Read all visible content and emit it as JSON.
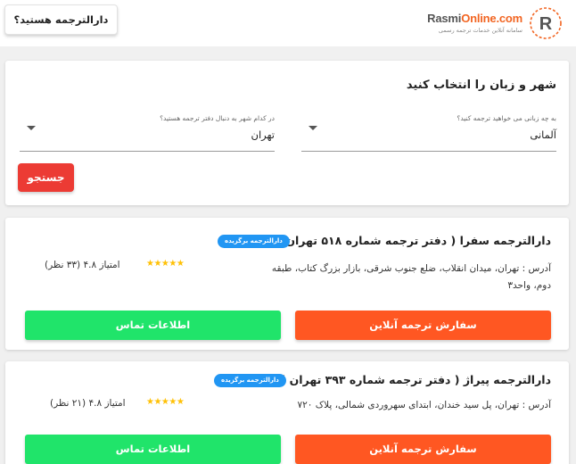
{
  "header": {
    "logo_brand": "Rasmi",
    "logo_domain": "Online.com",
    "logo_tagline": "سامانه آنلاین خدمات ترجمه رسمی",
    "question_button": "دارالترجمه هستید؟"
  },
  "search": {
    "title": "شهر و زبان را انتخاب کنید",
    "language_label": "به چه زبانی می خواهید ترجمه کنید؟",
    "language_value": "آلمانی",
    "city_label": "در کدام شهر به دنبال دفتر ترجمه هستید؟",
    "city_value": "تهران",
    "search_button": "جستجو"
  },
  "offices": [
    {
      "name": "دارالترجمه سفرا ( دفتر ترجمه شماره ۵۱۸ تهران )",
      "badge": "دارالترجمه برگزیده",
      "address": "آدرس : تهران، میدان انقلاب، ضلع جنوب شرقی، بازار بزرگ کتاب، طبقه دوم، واحد۳",
      "stars": "★★★★★",
      "rating": "امتیاز ۴.۸ (۳۳ نظر)",
      "order_button": "سفارش ترجمه آنلاین",
      "contact_button": "اطلاعات تماس"
    },
    {
      "name": "دارالترجمه پیراژ ( دفتر ترجمه شماره ۳۹۳ تهران )",
      "badge": "دارالترجمه برگزیده",
      "address": "آدرس : تهران، پل سید خندان، ابتدای سهروردی شمالی، پلاک ۷۲۰",
      "stars": "★★★★★",
      "rating": "امتیاز ۴.۸ (۲۱ نظر)",
      "order_button": "سفارش ترجمه آنلاین",
      "contact_button": "اطلاعات تماس"
    }
  ],
  "colors": {
    "accent_orange": "#ff5722",
    "contact_green": "#20e46a",
    "search_red": "#ec3b34",
    "badge_blue": "#2196f3"
  }
}
